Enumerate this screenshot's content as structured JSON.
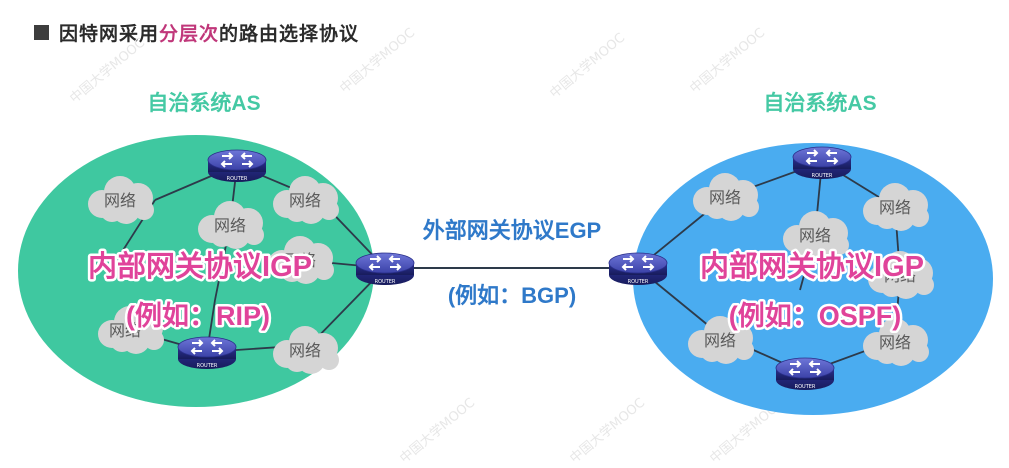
{
  "title": {
    "prefix": "因特网采用",
    "highlight": "分层次",
    "suffix": "的路由选择协议"
  },
  "as_left": {
    "label": "自治系统AS",
    "protocol": "内部网关协议IGP",
    "example": "(例如：RIP)",
    "networks": [
      "网络",
      "网络",
      "网络",
      "网络",
      "网络",
      "网络"
    ]
  },
  "as_right": {
    "label": "自治系统AS",
    "protocol": "内部网关协议IGP",
    "example": "(例如：OSPF)",
    "networks": [
      "网络",
      "网络",
      "网络",
      "网络",
      "网络",
      "网络"
    ]
  },
  "egp": {
    "protocol": "外部网关协议EGP",
    "example": "(例如：BGP)"
  },
  "router_label": "ROUTER",
  "watermark_text": "中国大学MOOC",
  "colors": {
    "as_left": "#3fc8a0",
    "as_right": "#4aacf0",
    "as_label": "#45c9a4",
    "protocol_text": "#e0439a",
    "egp_text": "#2f79c9",
    "highlight": "#c0377a"
  }
}
